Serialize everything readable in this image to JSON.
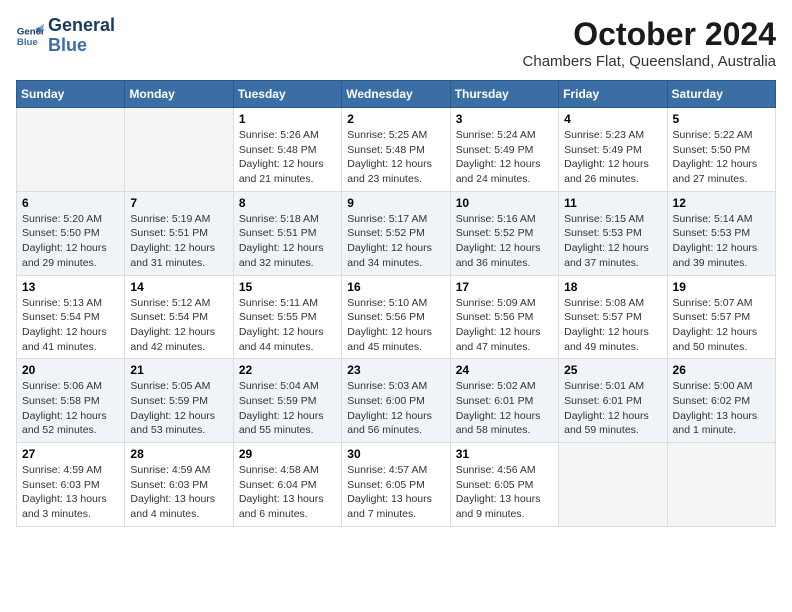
{
  "logo": {
    "line1": "General",
    "line2": "Blue"
  },
  "title": "October 2024",
  "subtitle": "Chambers Flat, Queensland, Australia",
  "headers": [
    "Sunday",
    "Monday",
    "Tuesday",
    "Wednesday",
    "Thursday",
    "Friday",
    "Saturday"
  ],
  "weeks": [
    [
      {
        "day": "",
        "info": ""
      },
      {
        "day": "",
        "info": ""
      },
      {
        "day": "1",
        "info": "Sunrise: 5:26 AM\nSunset: 5:48 PM\nDaylight: 12 hours\nand 21 minutes."
      },
      {
        "day": "2",
        "info": "Sunrise: 5:25 AM\nSunset: 5:48 PM\nDaylight: 12 hours\nand 23 minutes."
      },
      {
        "day": "3",
        "info": "Sunrise: 5:24 AM\nSunset: 5:49 PM\nDaylight: 12 hours\nand 24 minutes."
      },
      {
        "day": "4",
        "info": "Sunrise: 5:23 AM\nSunset: 5:49 PM\nDaylight: 12 hours\nand 26 minutes."
      },
      {
        "day": "5",
        "info": "Sunrise: 5:22 AM\nSunset: 5:50 PM\nDaylight: 12 hours\nand 27 minutes."
      }
    ],
    [
      {
        "day": "6",
        "info": "Sunrise: 5:20 AM\nSunset: 5:50 PM\nDaylight: 12 hours\nand 29 minutes."
      },
      {
        "day": "7",
        "info": "Sunrise: 5:19 AM\nSunset: 5:51 PM\nDaylight: 12 hours\nand 31 minutes."
      },
      {
        "day": "8",
        "info": "Sunrise: 5:18 AM\nSunset: 5:51 PM\nDaylight: 12 hours\nand 32 minutes."
      },
      {
        "day": "9",
        "info": "Sunrise: 5:17 AM\nSunset: 5:52 PM\nDaylight: 12 hours\nand 34 minutes."
      },
      {
        "day": "10",
        "info": "Sunrise: 5:16 AM\nSunset: 5:52 PM\nDaylight: 12 hours\nand 36 minutes."
      },
      {
        "day": "11",
        "info": "Sunrise: 5:15 AM\nSunset: 5:53 PM\nDaylight: 12 hours\nand 37 minutes."
      },
      {
        "day": "12",
        "info": "Sunrise: 5:14 AM\nSunset: 5:53 PM\nDaylight: 12 hours\nand 39 minutes."
      }
    ],
    [
      {
        "day": "13",
        "info": "Sunrise: 5:13 AM\nSunset: 5:54 PM\nDaylight: 12 hours\nand 41 minutes."
      },
      {
        "day": "14",
        "info": "Sunrise: 5:12 AM\nSunset: 5:54 PM\nDaylight: 12 hours\nand 42 minutes."
      },
      {
        "day": "15",
        "info": "Sunrise: 5:11 AM\nSunset: 5:55 PM\nDaylight: 12 hours\nand 44 minutes."
      },
      {
        "day": "16",
        "info": "Sunrise: 5:10 AM\nSunset: 5:56 PM\nDaylight: 12 hours\nand 45 minutes."
      },
      {
        "day": "17",
        "info": "Sunrise: 5:09 AM\nSunset: 5:56 PM\nDaylight: 12 hours\nand 47 minutes."
      },
      {
        "day": "18",
        "info": "Sunrise: 5:08 AM\nSunset: 5:57 PM\nDaylight: 12 hours\nand 49 minutes."
      },
      {
        "day": "19",
        "info": "Sunrise: 5:07 AM\nSunset: 5:57 PM\nDaylight: 12 hours\nand 50 minutes."
      }
    ],
    [
      {
        "day": "20",
        "info": "Sunrise: 5:06 AM\nSunset: 5:58 PM\nDaylight: 12 hours\nand 52 minutes."
      },
      {
        "day": "21",
        "info": "Sunrise: 5:05 AM\nSunset: 5:59 PM\nDaylight: 12 hours\nand 53 minutes."
      },
      {
        "day": "22",
        "info": "Sunrise: 5:04 AM\nSunset: 5:59 PM\nDaylight: 12 hours\nand 55 minutes."
      },
      {
        "day": "23",
        "info": "Sunrise: 5:03 AM\nSunset: 6:00 PM\nDaylight: 12 hours\nand 56 minutes."
      },
      {
        "day": "24",
        "info": "Sunrise: 5:02 AM\nSunset: 6:01 PM\nDaylight: 12 hours\nand 58 minutes."
      },
      {
        "day": "25",
        "info": "Sunrise: 5:01 AM\nSunset: 6:01 PM\nDaylight: 12 hours\nand 59 minutes."
      },
      {
        "day": "26",
        "info": "Sunrise: 5:00 AM\nSunset: 6:02 PM\nDaylight: 13 hours\nand 1 minute."
      }
    ],
    [
      {
        "day": "27",
        "info": "Sunrise: 4:59 AM\nSunset: 6:03 PM\nDaylight: 13 hours\nand 3 minutes."
      },
      {
        "day": "28",
        "info": "Sunrise: 4:59 AM\nSunset: 6:03 PM\nDaylight: 13 hours\nand 4 minutes."
      },
      {
        "day": "29",
        "info": "Sunrise: 4:58 AM\nSunset: 6:04 PM\nDaylight: 13 hours\nand 6 minutes."
      },
      {
        "day": "30",
        "info": "Sunrise: 4:57 AM\nSunset: 6:05 PM\nDaylight: 13 hours\nand 7 minutes."
      },
      {
        "day": "31",
        "info": "Sunrise: 4:56 AM\nSunset: 6:05 PM\nDaylight: 13 hours\nand 9 minutes."
      },
      {
        "day": "",
        "info": ""
      },
      {
        "day": "",
        "info": ""
      }
    ]
  ]
}
